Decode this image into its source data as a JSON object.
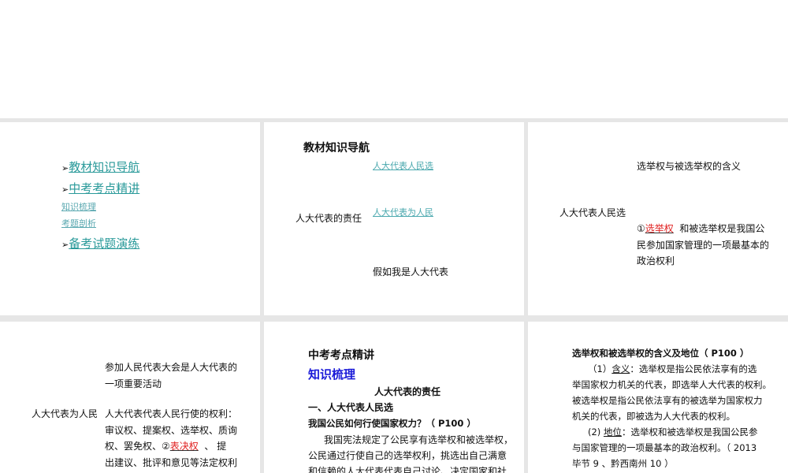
{
  "slide1": {
    "nav": [
      "教材知识导航",
      "中考考点精讲",
      "备考试题演练"
    ],
    "sub": [
      "知识梳理",
      "考题剖析"
    ],
    "arrow": "➢"
  },
  "slide2": {
    "title": "教材知识导航",
    "center": "人大代表的责任",
    "links": [
      "人大代表人民选",
      "人大代表为人民"
    ],
    "item3": "假如我是人大代表"
  },
  "slide3": {
    "heading": "选举权与被选举权的含义",
    "left": "人大代表人民选",
    "num": "①",
    "blank": "选举权",
    "line1": "和被选举权是我国公",
    "line2": "民参加国家管理的一项最基本的",
    "line3": "政治权利"
  },
  "slide4": {
    "p1": [
      "参加人民代表大会是人大代表的",
      "一项重要活动"
    ],
    "left": "人大代表为人民",
    "p2_line1": "人大代表代表人民行使的权利：",
    "p2_line2": "审议权、提案权、选举权、质询",
    "p2_line3a": "权、罢免权、②",
    "blank": "表决权",
    "p2_line3b": "、 提",
    "p2_line4": "出建议、批评和意见等法定权利"
  },
  "slide5": {
    "title": "中考考点精讲",
    "subtitle": "知识梳理",
    "center": "人大代表的责任",
    "section": "一、人大代表人民选",
    "question": "我国公民如何行使国家权力？（ P100 ）",
    "body": [
      "我国宪法规定了公民享有选举权和被选举权，",
      "公民通过行使自己的选举权利，挑选出自己满意",
      "和信赖的人大代表代表自己讨论、决定国家和社"
    ]
  },
  "slide6": {
    "title": "选举权和被选举权的含义及地位（ P100 ）",
    "l1a": "（1）",
    "l1u": "含义",
    "l1b": "：选举权是指公民依法享有的选",
    "l2": "举国家权力机关的代表，即选举人大代表的权利。",
    "l3": "被选举权是指公民依法享有的被选举为国家权力",
    "l4": "机关的代表，即被选为人大代表的权利。",
    "l5a": "(2) ",
    "l5u": "地位",
    "l5b": "：选举权和被选举权是我国公民参",
    "l6": "与国家管理的一项最基本的政治权利。（ 2013",
    "l7": "毕节 9 、黔西南州 10 ）"
  }
}
